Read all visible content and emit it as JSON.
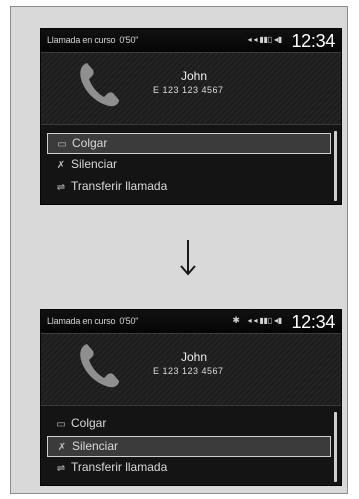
{
  "screens": [
    {
      "status": {
        "left_text": "Llamada en curso",
        "duration": "0'50\"",
        "icons_text": "◂ ◂ ▮▮▯ ◂▮",
        "bt_icon": "",
        "clock": "12:34"
      },
      "call": {
        "name": "John",
        "number": "E 123 123 4567"
      },
      "menu": [
        {
          "icon": "phone-down-icon",
          "glyph": "▭",
          "label": "Colgar"
        },
        {
          "icon": "mute-icon",
          "glyph": "✗",
          "label": "Silenciar"
        },
        {
          "icon": "transfer-icon",
          "glyph": "⇌",
          "label": "Transferir llamada"
        }
      ],
      "selected_index": 0
    },
    {
      "status": {
        "left_text": "Llamada en curso",
        "duration": "0'50\"",
        "icons_text": "◂ ◂ ▮▮▯ ◂▮",
        "bt_icon": "✱",
        "clock": "12:34"
      },
      "call": {
        "name": "John",
        "number": "E 123 123 4567"
      },
      "menu": [
        {
          "icon": "phone-down-icon",
          "glyph": "▭",
          "label": "Colgar"
        },
        {
          "icon": "mute-icon",
          "glyph": "✗",
          "label": "Silenciar"
        },
        {
          "icon": "transfer-icon",
          "glyph": "⇌",
          "label": "Transferir llamada"
        }
      ],
      "selected_index": 1
    }
  ],
  "arrow_icon": "down-arrow-icon",
  "colors": {
    "frame_bg": "#d9d9d9",
    "screen_bg": "#1b1b1b",
    "highlight_border": "#cfcfcf",
    "text": "#d8d8d8"
  }
}
